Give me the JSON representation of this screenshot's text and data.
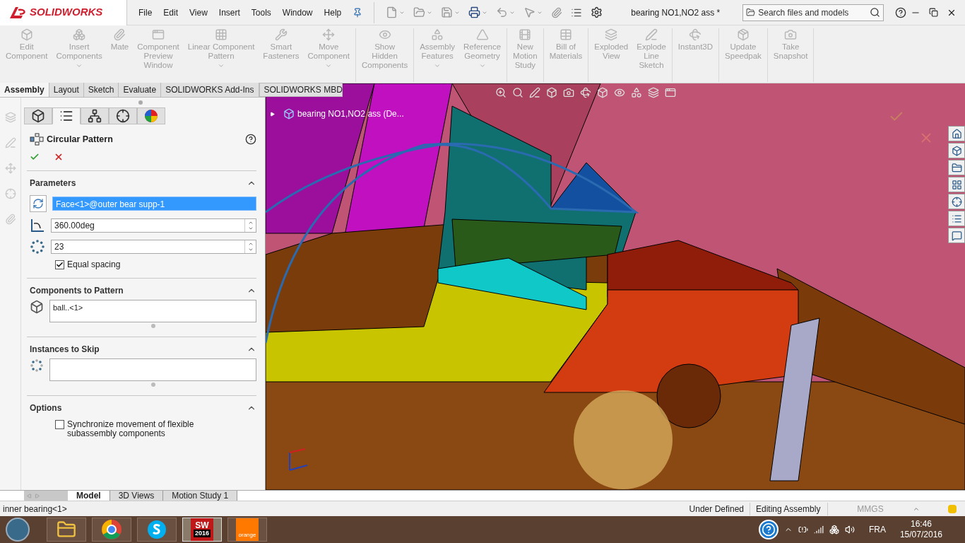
{
  "logo": {
    "text": "SOLIDWORKS"
  },
  "menu": [
    {
      "label": "File"
    },
    {
      "label": "Edit"
    },
    {
      "label": "View"
    },
    {
      "label": "Insert"
    },
    {
      "label": "Tools"
    },
    {
      "label": "Window"
    },
    {
      "label": "Help"
    }
  ],
  "document_title": "bearing NO1,NO2 ass *",
  "search": {
    "placeholder": "Search files and models"
  },
  "ribbon_groups": [
    [
      {
        "lines": [
          "Edit",
          "Component"
        ],
        "disabled": true,
        "dropdown": false
      },
      {
        "lines": [
          "Insert",
          "Components"
        ],
        "disabled": true,
        "dropdown": true
      },
      {
        "lines": [
          "Mate"
        ],
        "disabled": true,
        "dropdown": false
      },
      {
        "lines": [
          "Component",
          "Preview",
          "Window"
        ],
        "disabled": true,
        "dropdown": false
      },
      {
        "lines": [
          "Linear Component",
          "Pattern"
        ],
        "disabled": true,
        "dropdown": true
      },
      {
        "lines": [
          "Smart",
          "Fasteners"
        ],
        "disabled": true,
        "dropdown": false
      },
      {
        "lines": [
          "Move",
          "Component"
        ],
        "disabled": true,
        "dropdown": true
      }
    ],
    [
      {
        "lines": [
          "Show",
          "Hidden",
          "Components"
        ],
        "disabled": true,
        "dropdown": false
      }
    ],
    [
      {
        "lines": [
          "Assembly",
          "Features"
        ],
        "disabled": true,
        "dropdown": true
      },
      {
        "lines": [
          "Reference",
          "Geometry"
        ],
        "disabled": true,
        "dropdown": true
      }
    ],
    [
      {
        "lines": [
          "New",
          "Motion",
          "Study"
        ],
        "disabled": true,
        "dropdown": false
      }
    ],
    [
      {
        "lines": [
          "Bill of",
          "Materials"
        ],
        "disabled": true,
        "dropdown": false
      }
    ],
    [
      {
        "lines": [
          "Exploded",
          "View"
        ],
        "disabled": true,
        "dropdown": false
      },
      {
        "lines": [
          "Explode",
          "Line",
          "Sketch"
        ],
        "disabled": true,
        "dropdown": false
      }
    ],
    [
      {
        "lines": [
          "Instant3D"
        ],
        "disabled": true,
        "dropdown": false
      }
    ],
    [
      {
        "lines": [
          "Update",
          "Speedpak"
        ],
        "disabled": true,
        "dropdown": false
      }
    ],
    [
      {
        "lines": [
          "Take",
          "Snapshot"
        ],
        "disabled": true,
        "dropdown": false
      }
    ]
  ],
  "command_tabs": [
    {
      "label": "Assembly",
      "selected": true
    },
    {
      "label": "Layout",
      "selected": false
    },
    {
      "label": "Sketch",
      "selected": false
    },
    {
      "label": "Evaluate",
      "selected": false
    },
    {
      "label": "SOLIDWORKS Add-Ins",
      "selected": false
    },
    {
      "label": "SOLIDWORKS MBD",
      "selected": false
    }
  ],
  "panel_tabs": [
    {
      "selected": false
    },
    {
      "selected": true
    },
    {
      "selected": false
    },
    {
      "selected": false
    },
    {
      "selected": false
    }
  ],
  "property_manager": {
    "title": "Circular Pattern",
    "sections": [
      {
        "title": "Parameters",
        "expanded": true,
        "rows": [
          {
            "kind": "selection",
            "value": "Face<1>@outer bear supp-1",
            "highlighted": true
          },
          {
            "kind": "spin",
            "value": "360.00deg"
          },
          {
            "kind": "spin",
            "value": "23"
          },
          {
            "kind": "checkbox",
            "label": "Equal spacing",
            "checked": true
          }
        ]
      },
      {
        "title": "Components to Pattern",
        "expanded": true,
        "rows": [
          {
            "kind": "list",
            "items": [
              "ball..<1>"
            ]
          }
        ]
      },
      {
        "title": "Instances to Skip",
        "expanded": true,
        "rows": [
          {
            "kind": "list"
          }
        ]
      },
      {
        "title": "Options",
        "expanded": true,
        "rows": [
          {
            "kind": "checkbox",
            "label": "Synchronize movement of flexible subassembly components",
            "checked": false
          }
        ]
      }
    ]
  },
  "feature_tree": {
    "label": "bearing NO1,NO2 ass  (De...",
    "expanded": false
  },
  "bottom_tabs": [
    {
      "label": "Model",
      "selected": true
    },
    {
      "label": "3D Views",
      "selected": false
    },
    {
      "label": "Motion Study 1",
      "selected": false
    }
  ],
  "status_bar": {
    "selection": "inner bearing<1>",
    "state": "Under Defined",
    "mode": "Editing Assembly",
    "units": "MMGS"
  },
  "taskbar": {
    "apps": [
      {
        "kind": "explorer",
        "active": false
      },
      {
        "kind": "chrome",
        "active": false
      },
      {
        "kind": "skype",
        "active": false
      },
      {
        "kind": "solidworks",
        "label": "SW",
        "badge": "2016",
        "active": true
      },
      {
        "kind": "orange",
        "label": "orange",
        "active": false
      }
    ],
    "language": "FRA",
    "time": "16:46",
    "date": "15/07/2016"
  }
}
